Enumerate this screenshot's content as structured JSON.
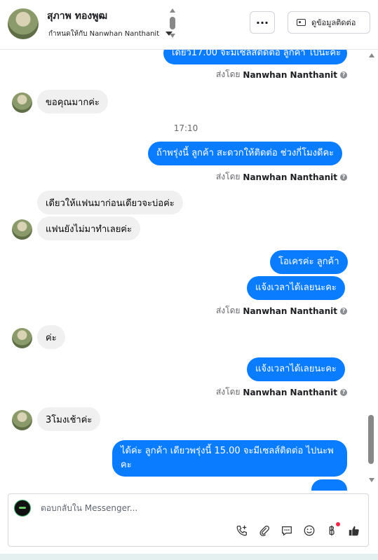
{
  "header": {
    "contact_name": "สุภาพ ทองพูฒ",
    "assigned_text": "กำหนดให้กับ Nanwhan Nanthanit",
    "more_label": "···",
    "contact_info_label": "ดูข้อมูลติดต่อ"
  },
  "messages": {
    "m0_partial": "เดียว17.00 จะมีเซลส์ติดต่อ ลูกค้า ไปนะคะ",
    "sent_by_prefix": "ส่งโดย",
    "sent_by_name": "Nanwhan Nanthanit",
    "m1_in": "ขอคุณมากค่ะ",
    "time_1710": "17:10",
    "m2_out": "ถ้าพรุ่งนี้ ลูกค้า สะดวกให้ติดต่อ ช่วงกี่โมงดีคะ",
    "m3_in": "เดียวให้แฟนมาก่อนเดียวจะบ่อค่ะ",
    "m4_in": "แฟนยังไม่มาทำเลยค่ะ",
    "m5_out": "โอเครค่ะ ลูกค้า",
    "m6_out": "แจ้งเวลาได้เลยนะคะ",
    "m7_in": "ค่ะ",
    "m8_out": "แจ้งเวลาได้เลยนะคะ",
    "m9_in": "3โมงเช้าค่ะ",
    "m10_out": "ได้ค่ะ ลูกค้า เดียวพรุ่งนี้ 15.00 จะมีเซลส์ติดต่อ ไปนะพ คะ"
  },
  "composer": {
    "placeholder": "ตอบกลับใน Messenger..."
  },
  "icons": [
    "call-add-icon",
    "paperclip-icon",
    "saved-reply-icon",
    "emoji-icon",
    "baht-icon",
    "thumbs-up-icon"
  ],
  "colors": {
    "outgoing_bubble": "#0a7cff",
    "incoming_bubble": "#f0f0f0",
    "notification_dot": "#f02849"
  }
}
